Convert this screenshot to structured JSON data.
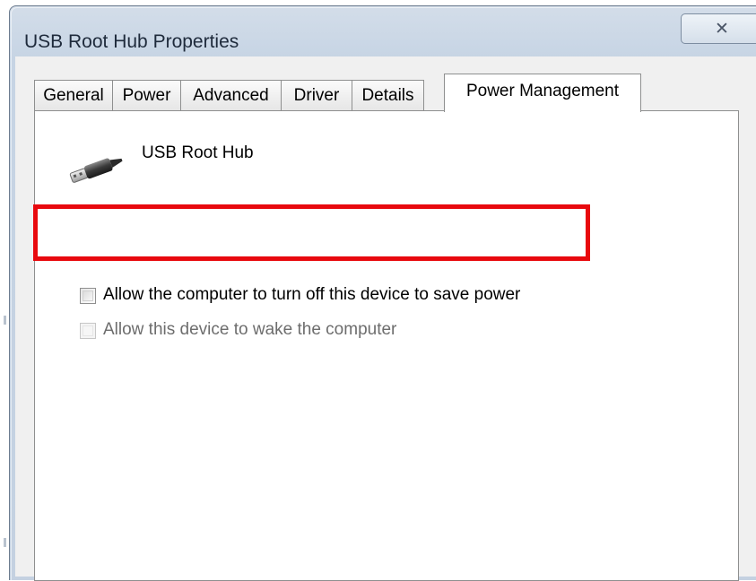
{
  "window": {
    "title": "USB Root Hub Properties",
    "close_glyph": "✕"
  },
  "tabs": [
    {
      "label": "General",
      "active": false
    },
    {
      "label": "Power",
      "active": false
    },
    {
      "label": "Advanced",
      "active": false
    },
    {
      "label": "Driver",
      "active": false
    },
    {
      "label": "Details",
      "active": false
    },
    {
      "label": "Power Management",
      "active": true
    }
  ],
  "device": {
    "icon": "usb-connector-icon",
    "name": "USB Root Hub"
  },
  "options": {
    "allow_turn_off": {
      "label": "Allow the computer to turn off this device to save power",
      "checked": false,
      "enabled": true
    },
    "allow_wake": {
      "label": "Allow this device to wake the computer",
      "checked": false,
      "enabled": false
    }
  },
  "annotation": {
    "highlight_color": "#e8090e"
  }
}
